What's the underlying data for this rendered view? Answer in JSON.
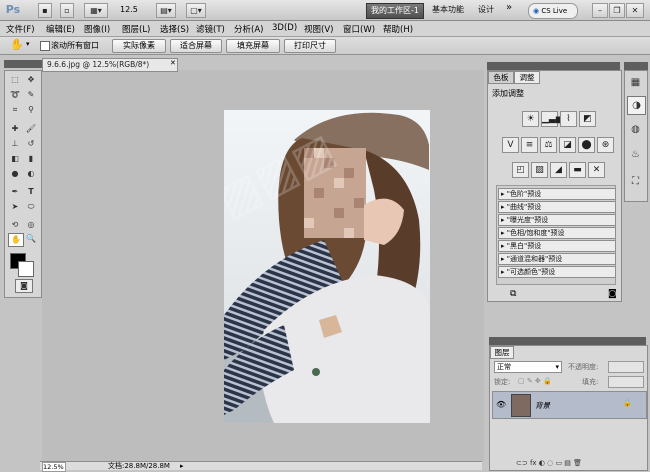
{
  "titlebar": {
    "ps_logo": "Ps",
    "zoom": "12.5",
    "workspace_active": "我的工作区-1",
    "workspace_basic": "基本功能",
    "workspace_design": "设计",
    "more": "»",
    "cs_live": "CS Live"
  },
  "menu": {
    "items": [
      "文件(F)",
      "编辑(E)",
      "图像(I)",
      "图层(L)",
      "选择(S)",
      "滤镜(T)",
      "分析(A)",
      "3D(D)",
      "视图(V)",
      "窗口(W)",
      "帮助(H)"
    ]
  },
  "options": {
    "scroll_all_windows": "滚动所有窗口",
    "actual_pixels": "实际像素",
    "fit_screen": "适合屏幕",
    "fill_screen": "填充屏幕",
    "print_size": "打印尺寸"
  },
  "document": {
    "tab_title": "9.6.6.jpg @ 12.5%(RGB/8*)"
  },
  "adjustments": {
    "tab_color": "色板",
    "tab_adjust": "调整",
    "add_adjustment": "添加调整",
    "presets": [
      "\"色阶\"预设",
      "\"曲线\"预设",
      "\"曝光度\"预设",
      "\"色相/饱和度\"预设",
      "\"黑白\"预设",
      "\"通道混和器\"预设",
      "\"可选颜色\"预设"
    ]
  },
  "layers": {
    "tab": "图层",
    "blend_mode": "正常",
    "opacity_label": "不透明度:",
    "lock_label": "锁定:",
    "fill_label": "填充:",
    "layer_name": "背景"
  },
  "status": {
    "zoom": "12.5%",
    "doc_size": "文档:28.8M/28.8M"
  },
  "colors": {
    "accent": "#5a5a5a"
  }
}
